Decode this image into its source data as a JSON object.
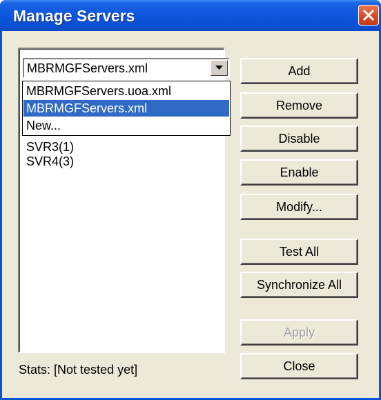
{
  "window": {
    "title": "Manage Servers"
  },
  "server_list": {
    "items": [
      {
        "label": "SVR3(1)"
      },
      {
        "label": "SVR4(3)"
      }
    ]
  },
  "config_select": {
    "value": "MBRMGFServers.xml",
    "options": [
      {
        "label": "MBRMGFServers.uoa.xml",
        "selected": false
      },
      {
        "label": "MBRMGFServers.xml",
        "selected": true
      },
      {
        "label": "New...",
        "selected": false
      }
    ]
  },
  "buttons": {
    "add": "Add",
    "remove": "Remove",
    "disable": "Disable",
    "enable": "Enable",
    "modify": "Modify...",
    "test_all": "Test All",
    "synchronize_all": "Synchronize All",
    "apply": "Apply",
    "close": "Close"
  },
  "status": {
    "stats": "Stats: [Not tested yet]"
  },
  "colors": {
    "title_bar": "#0c55dc",
    "close_button": "#d94a26",
    "selection": "#316ac5",
    "dialog_face": "#ece9d8"
  },
  "icons": {
    "close": "close-x-icon",
    "dropdown": "chevron-down-icon"
  }
}
